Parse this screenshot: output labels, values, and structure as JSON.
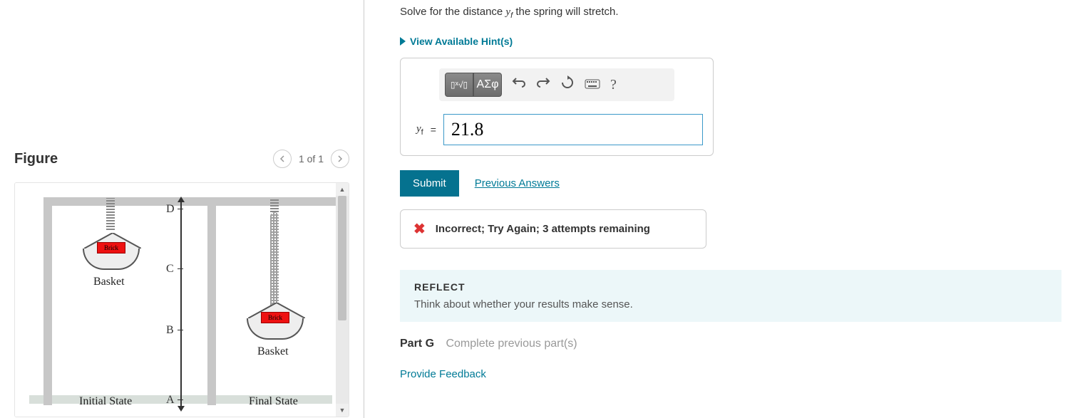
{
  "figure": {
    "title": "Figure",
    "nav_count": "1 of 1",
    "labels": {
      "A": "A",
      "B": "B",
      "C": "C",
      "D": "D",
      "brick": "Brick",
      "basket": "Basket",
      "initial": "Initial State",
      "final": "Final State"
    }
  },
  "question": {
    "instruction_pre": "Solve for the distance ",
    "variable": "y",
    "subscript": "f",
    "instruction_post": " the spring will stretch.",
    "hints_toggle": "View Available Hint(s)"
  },
  "toolbar": {
    "templates": "▯√▯",
    "greek": "ΑΣφ",
    "help": "?"
  },
  "input": {
    "label_var": "y",
    "label_sub": "f",
    "equals": " = ",
    "value": "21.8"
  },
  "actions": {
    "submit": "Submit",
    "previous": "Previous Answers"
  },
  "feedback": {
    "text": "Incorrect; Try Again; 3 attempts remaining"
  },
  "reflect": {
    "title": "REFLECT",
    "text": "Think about whether your results make sense."
  },
  "partg": {
    "label": "Part G",
    "text": "Complete previous part(s)"
  },
  "footer": {
    "feedback_link": "Provide Feedback"
  }
}
